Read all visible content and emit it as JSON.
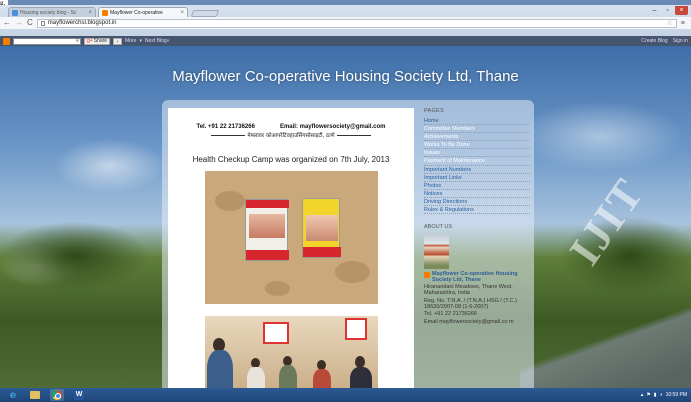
{
  "figure_label": "g.",
  "browser": {
    "tabs": [
      {
        "title": "Housing society blog - Sc"
      },
      {
        "title": "Mayflower Co-operative"
      }
    ],
    "url": "mayflowerchsl.blogspot.in"
  },
  "blogger_bar": {
    "share_label": "Share",
    "more_label": "More",
    "next_blog_label": "Next Blog»",
    "create_blog_label": "Create Blog",
    "sign_in_label": "Sign in"
  },
  "blog": {
    "title": "Mayflower Co-operative Housing Society Ltd, Thane",
    "watermark": "IJIT"
  },
  "post": {
    "letterhead_tel": "Tel. +91 22 21736266",
    "letterhead_email": "Email: mayflowersociety@gmail.com",
    "letterhead_marathi": "मेफ्लावर कोआपरेटिवहाउसिंगसोसाइटी, ठाणे",
    "heading": "Health Checkup Camp was organized on 7th July, 2013"
  },
  "sidebar": {
    "pages_heading": "PAGES",
    "pages": [
      {
        "label": "Home",
        "style": "link"
      },
      {
        "label": "Committee Members",
        "style": "plain"
      },
      {
        "label": "Achievements",
        "style": "plain"
      },
      {
        "label": "Works To Be Done",
        "style": "plain"
      },
      {
        "label": "Issues",
        "style": "plain"
      },
      {
        "label": "Payment of Maintenance",
        "style": "plain"
      },
      {
        "label": "Important Numbers",
        "style": "link"
      },
      {
        "label": "Important Links",
        "style": "link"
      },
      {
        "label": "Photos",
        "style": "link"
      },
      {
        "label": "Notices",
        "style": "link"
      },
      {
        "label": "Driving Directions",
        "style": "link"
      },
      {
        "label": "Rules & Regulations",
        "style": "link"
      }
    ],
    "about_heading": "ABOUT US",
    "about_name": "Mayflower Co-operative Housing Society Ltd, Thane",
    "about_address": "Hiranandani Meadows, Thane West, Maharashtra, India",
    "about_reg": "Reg. No. T.N.A. / (T.N.A.) HSG / (T.C.) 18630/2007-08 (1-6-2007)",
    "about_tel": "Tel. +91 22 21736266",
    "about_email": "Email mayflowersociety@gmail.co m"
  },
  "taskbar": {
    "time": "10:59 PM"
  },
  "colors": {
    "link": "#2c5d99",
    "blogger_orange": "#f57d00",
    "taskbar": "#1e4579"
  }
}
